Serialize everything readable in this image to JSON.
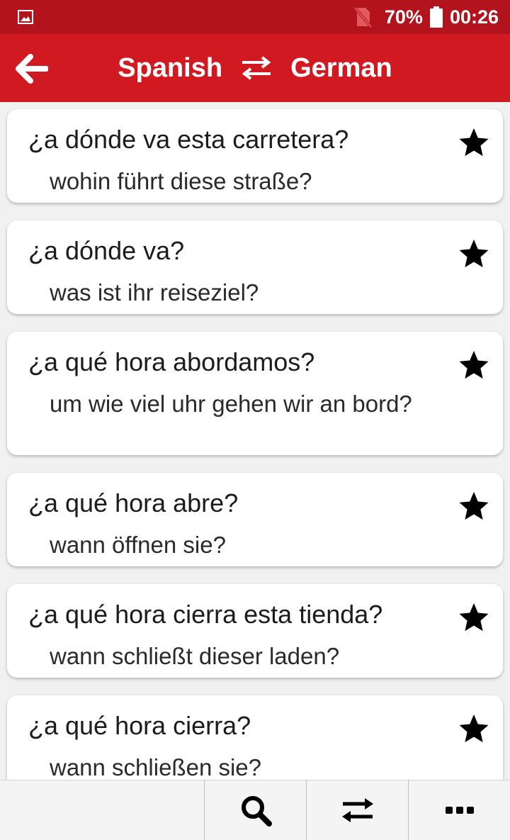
{
  "status_bar": {
    "battery": "70%",
    "time": "00:26",
    "icons": [
      "image-notification-icon",
      "no-sim-icon",
      "battery-icon"
    ]
  },
  "header": {
    "source_language": "Spanish",
    "target_language": "German",
    "icons": [
      "back-arrow-icon",
      "swap-arrows-icon"
    ]
  },
  "phrases": [
    {
      "source": "¿a dónde va esta carretera?",
      "target": "wohin führt diese straße?"
    },
    {
      "source": "¿a dónde va?",
      "target": "was ist ihr reiseziel?"
    },
    {
      "source": "¿a qué hora abordamos?",
      "target": "um wie viel uhr gehen wir an bord?"
    },
    {
      "source": "¿a qué hora abre?",
      "target": "wann öffnen sie?"
    },
    {
      "source": "¿a qué hora cierra esta tienda?",
      "target": "wann schließt dieser laden?"
    },
    {
      "source": "¿a qué hora cierra?",
      "target": "wann schließen sie?"
    }
  ],
  "bottom_bar": {
    "icons": [
      "search-icon",
      "swap-icon",
      "more-icon"
    ]
  },
  "colors": {
    "status_bar": "#b3131d",
    "app_bar": "#d01920",
    "background": "#f1f1f1",
    "card": "#ffffff"
  }
}
